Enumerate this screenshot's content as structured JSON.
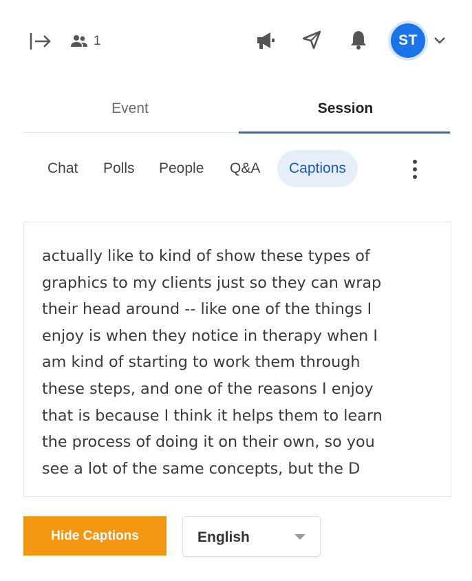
{
  "topbar": {
    "participants_count": "1",
    "avatar_initials": "ST",
    "icons": [
      "collapse-panel-icon",
      "people-icon",
      "megaphone-icon",
      "send-icon",
      "bell-icon",
      "chevron-down-icon"
    ]
  },
  "main_tabs": [
    {
      "label": "Event",
      "active": false
    },
    {
      "label": "Session",
      "active": true
    }
  ],
  "sub_tabs": [
    {
      "label": "Chat",
      "active": false
    },
    {
      "label": "Polls",
      "active": false
    },
    {
      "label": "People",
      "active": false
    },
    {
      "label": "Q&A",
      "active": false
    },
    {
      "label": "Captions",
      "active": true
    }
  ],
  "captions": {
    "lines": [
      "actually like to kind of show these types of",
      "graphics to my clients just so they can wrap",
      "their head around -- like one of the things I",
      "enjoy is when they notice in therapy when I",
      "am kind of starting to work them through",
      "these steps, and one of the reasons I enjoy",
      "that is because I think it helps them to learn",
      "the process of doing it on their own, so you",
      "see a lot of the same concepts, but the D"
    ]
  },
  "footer": {
    "hide_captions_label": "Hide Captions",
    "language_selected": "English"
  },
  "colors": {
    "accent_blue": "#1a73e8",
    "active_tab_underline": "#2d6ea8",
    "captions_pill_bg": "#e6eef9",
    "hide_button_bg": "#f39612"
  }
}
